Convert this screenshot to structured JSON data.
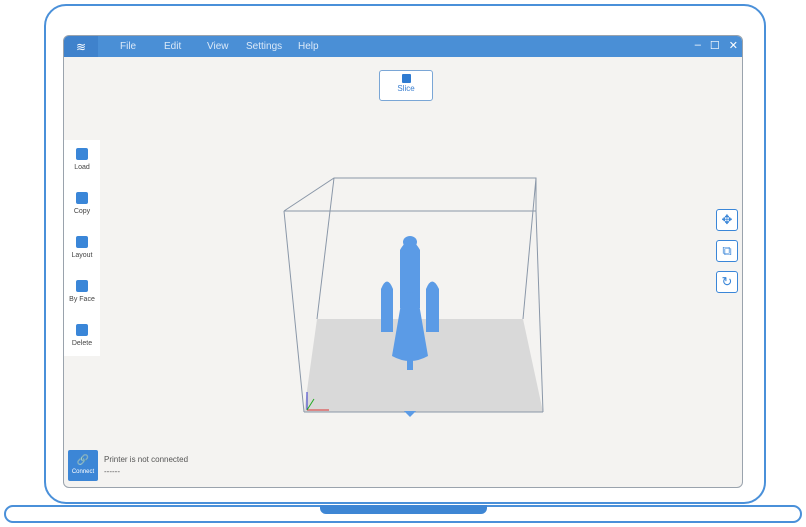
{
  "menu": {
    "items": [
      "File",
      "Edit",
      "View",
      "Settings",
      "Help"
    ]
  },
  "window_controls": {
    "minimize": "–",
    "maximize": "☐",
    "close": "✕"
  },
  "toolbar": {
    "slice_label": "Slice"
  },
  "left_tools": [
    {
      "label": "Load"
    },
    {
      "label": "Copy"
    },
    {
      "label": "Layout"
    },
    {
      "label": "By Face"
    },
    {
      "label": "Delete"
    }
  ],
  "right_tools": {
    "move": "✥",
    "scale": "⧉",
    "rotate": "↻"
  },
  "connect": {
    "label": "Connect",
    "icon": "🔗"
  },
  "status": {
    "message": "Printer is not connected",
    "detail": "------"
  },
  "colors": {
    "accent": "#4a8fd6",
    "model": "#5b9be6"
  }
}
